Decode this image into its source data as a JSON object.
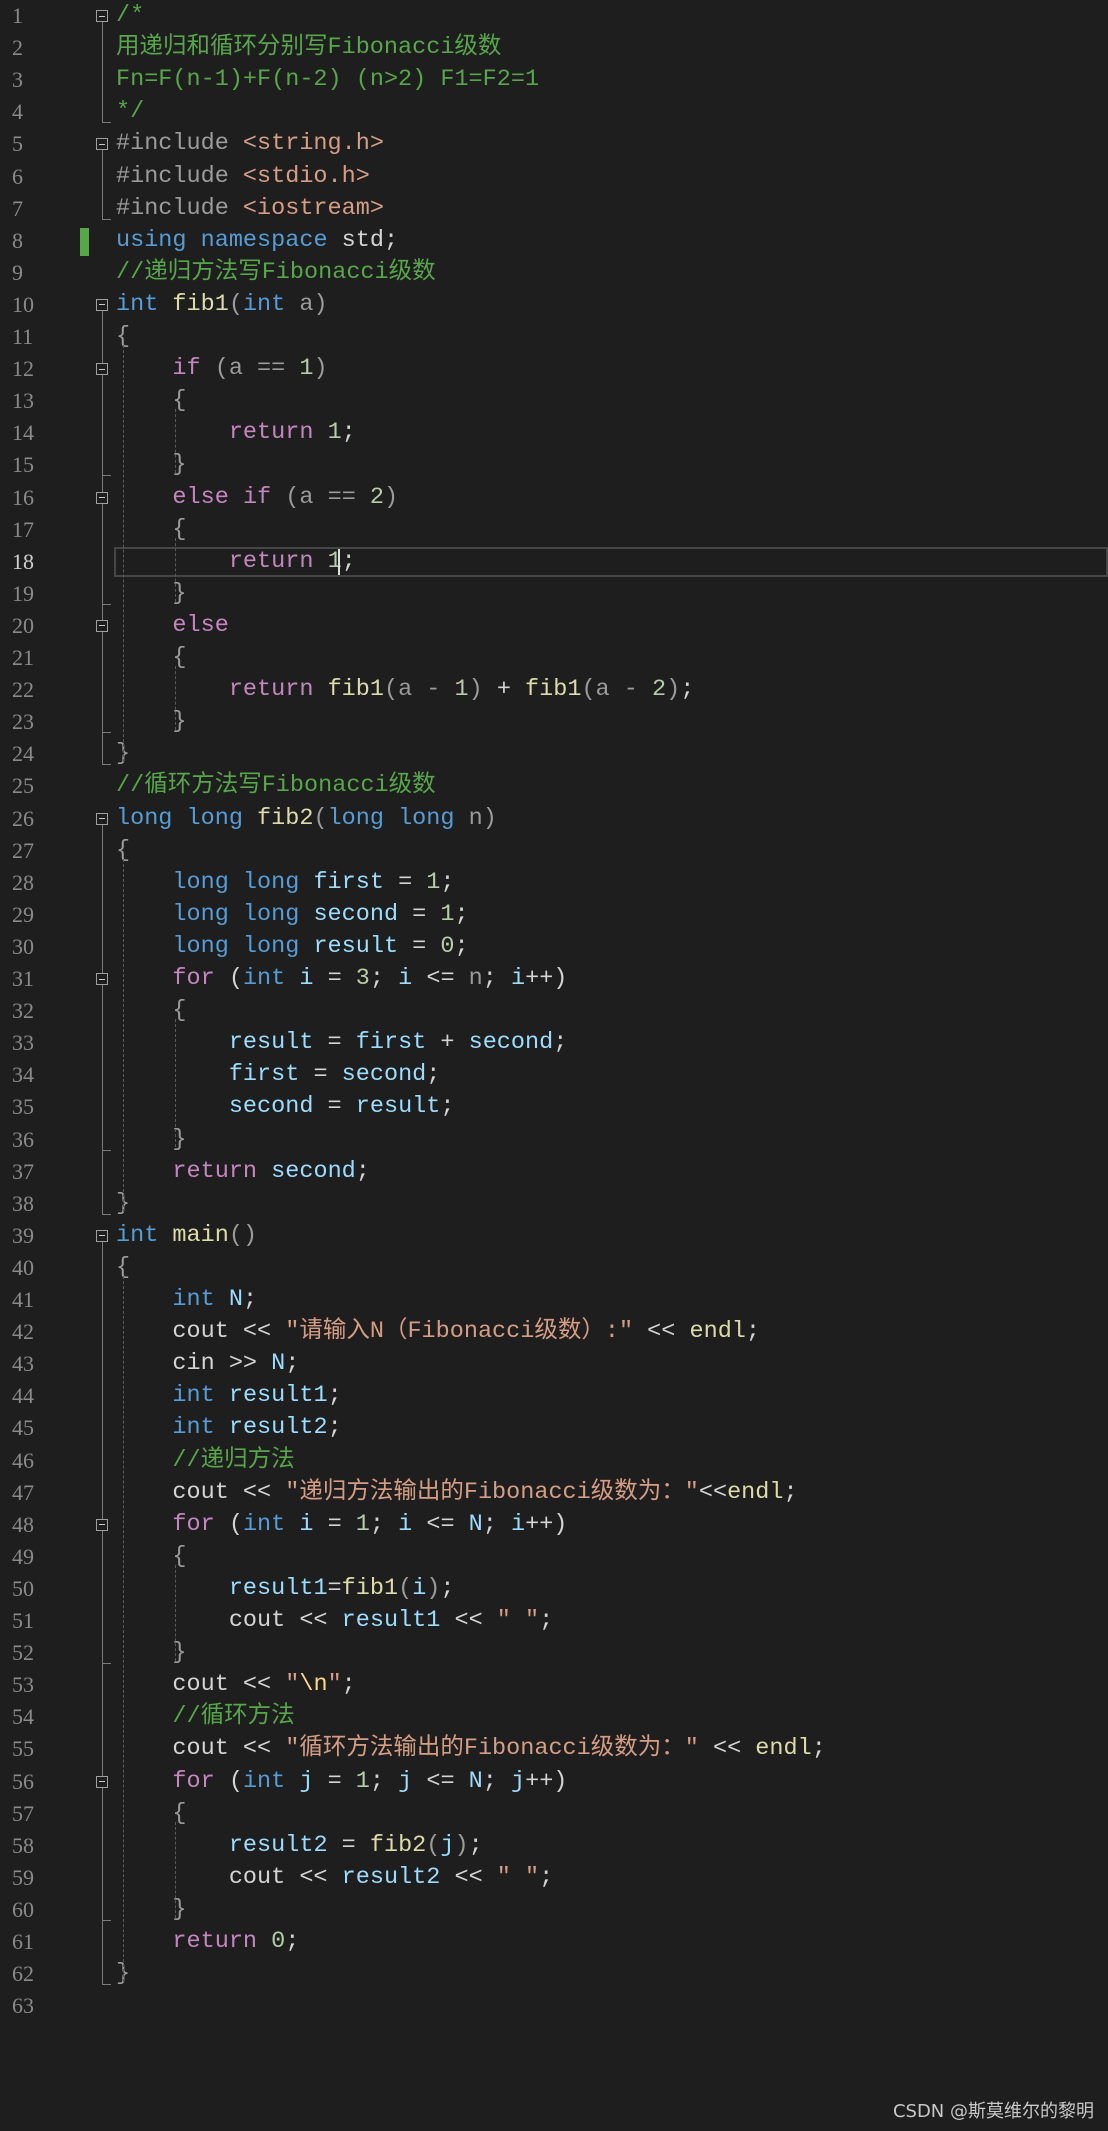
{
  "editor": {
    "active_line": 18,
    "line_numbers": [
      "1",
      "2",
      "3",
      "4",
      "5",
      "6",
      "7",
      "8",
      "9",
      "10",
      "11",
      "12",
      "13",
      "14",
      "15",
      "16",
      "17",
      "18",
      "19",
      "20",
      "21",
      "22",
      "23",
      "24",
      "25",
      "26",
      "27",
      "28",
      "29",
      "30",
      "31",
      "32",
      "33",
      "34",
      "35",
      "36",
      "37",
      "38",
      "39",
      "40",
      "41",
      "42",
      "43",
      "44",
      "45",
      "46",
      "47",
      "48",
      "49",
      "50",
      "51",
      "52",
      "53",
      "54",
      "55",
      "56",
      "57",
      "58",
      "59",
      "60",
      "61",
      "62",
      "63"
    ],
    "lines": [
      [
        [
          "cm",
          "/*"
        ]
      ],
      [
        [
          "cm",
          "用递归和循环分别写Fibonacci级数"
        ]
      ],
      [
        [
          "cm",
          "Fn=F(n-1)+F(n-2) (n>2) F1=F2=1"
        ]
      ],
      [
        [
          "cm",
          "*/"
        ]
      ],
      [
        [
          "pp",
          "#include "
        ],
        [
          "inc",
          "<string.h>"
        ]
      ],
      [
        [
          "pp",
          "#include "
        ],
        [
          "inc",
          "<stdio.h>"
        ]
      ],
      [
        [
          "pp",
          "#include "
        ],
        [
          "inc",
          "<iostream>"
        ]
      ],
      [
        [
          "k",
          "using"
        ],
        [
          "d",
          " "
        ],
        [
          "k",
          "namespace"
        ],
        [
          "d",
          " std;"
        ]
      ],
      [
        [
          "cm",
          "//递归方法写Fibonacci级数"
        ]
      ],
      [
        [
          "k",
          "int"
        ],
        [
          "d",
          " "
        ],
        [
          "f",
          "fib1"
        ],
        [
          "p",
          "("
        ],
        [
          "k",
          "int"
        ],
        [
          "d",
          " "
        ],
        [
          "p",
          "a)"
        ]
      ],
      [
        [
          "p",
          "{"
        ]
      ],
      [
        [
          "d",
          "    "
        ],
        [
          "c",
          "if"
        ],
        [
          "d",
          " "
        ],
        [
          "p",
          "(a == "
        ],
        [
          "n",
          "1"
        ],
        [
          "p",
          ")"
        ]
      ],
      [
        [
          "d",
          "    "
        ],
        [
          "p",
          "{"
        ]
      ],
      [
        [
          "d",
          "        "
        ],
        [
          "c",
          "return"
        ],
        [
          "d",
          " "
        ],
        [
          "n",
          "1"
        ],
        [
          "d",
          ";"
        ]
      ],
      [
        [
          "d",
          "    "
        ],
        [
          "p",
          "}"
        ]
      ],
      [
        [
          "d",
          "    "
        ],
        [
          "c",
          "else"
        ],
        [
          "d",
          " "
        ],
        [
          "c",
          "if"
        ],
        [
          "d",
          " "
        ],
        [
          "p",
          "(a == "
        ],
        [
          "n",
          "2"
        ],
        [
          "p",
          ")"
        ]
      ],
      [
        [
          "d",
          "    "
        ],
        [
          "p",
          "{"
        ]
      ],
      [
        [
          "d",
          "        "
        ],
        [
          "c",
          "return"
        ],
        [
          "d",
          " "
        ],
        [
          "n",
          "1"
        ],
        [
          "d",
          ";"
        ]
      ],
      [
        [
          "d",
          "    "
        ],
        [
          "p",
          "}"
        ]
      ],
      [
        [
          "d",
          "    "
        ],
        [
          "c",
          "else"
        ]
      ],
      [
        [
          "d",
          "    "
        ],
        [
          "p",
          "{"
        ]
      ],
      [
        [
          "d",
          "        "
        ],
        [
          "c",
          "return"
        ],
        [
          "d",
          " "
        ],
        [
          "f",
          "fib1"
        ],
        [
          "p",
          "(a - "
        ],
        [
          "n",
          "1"
        ],
        [
          "p",
          ")"
        ],
        [
          "d",
          " + "
        ],
        [
          "f",
          "fib1"
        ],
        [
          "p",
          "(a - "
        ],
        [
          "n",
          "2"
        ],
        [
          "p",
          ")"
        ],
        [
          "d",
          ";"
        ]
      ],
      [
        [
          "d",
          "    "
        ],
        [
          "p",
          "}"
        ]
      ],
      [
        [
          "p",
          "}"
        ]
      ],
      [
        [
          "cm",
          "//循环方法写Fibonacci级数"
        ]
      ],
      [
        [
          "k",
          "long long"
        ],
        [
          "d",
          " "
        ],
        [
          "f",
          "fib2"
        ],
        [
          "p",
          "("
        ],
        [
          "k",
          "long long"
        ],
        [
          "d",
          " "
        ],
        [
          "p",
          "n)"
        ]
      ],
      [
        [
          "p",
          "{"
        ]
      ],
      [
        [
          "d",
          "    "
        ],
        [
          "k",
          "long long"
        ],
        [
          "d",
          " "
        ],
        [
          "v",
          "first"
        ],
        [
          "d",
          " = "
        ],
        [
          "n",
          "1"
        ],
        [
          "d",
          ";"
        ]
      ],
      [
        [
          "d",
          "    "
        ],
        [
          "k",
          "long long"
        ],
        [
          "d",
          " "
        ],
        [
          "v",
          "second"
        ],
        [
          "d",
          " = "
        ],
        [
          "n",
          "1"
        ],
        [
          "d",
          ";"
        ]
      ],
      [
        [
          "d",
          "    "
        ],
        [
          "k",
          "long long"
        ],
        [
          "d",
          " "
        ],
        [
          "v",
          "result"
        ],
        [
          "d",
          " = "
        ],
        [
          "n",
          "0"
        ],
        [
          "d",
          ";"
        ]
      ],
      [
        [
          "d",
          "    "
        ],
        [
          "c",
          "for"
        ],
        [
          "d",
          " ("
        ],
        [
          "k",
          "int"
        ],
        [
          "d",
          " "
        ],
        [
          "v",
          "i"
        ],
        [
          "d",
          " = "
        ],
        [
          "n",
          "3"
        ],
        [
          "d",
          "; "
        ],
        [
          "v",
          "i"
        ],
        [
          "d",
          " <= "
        ],
        [
          "p",
          "n"
        ],
        [
          "d",
          "; "
        ],
        [
          "v",
          "i"
        ],
        [
          "d",
          "++)"
        ]
      ],
      [
        [
          "d",
          "    "
        ],
        [
          "p",
          "{"
        ]
      ],
      [
        [
          "d",
          "        "
        ],
        [
          "v",
          "result"
        ],
        [
          "d",
          " = "
        ],
        [
          "v",
          "first"
        ],
        [
          "d",
          " + "
        ],
        [
          "v",
          "second"
        ],
        [
          "d",
          ";"
        ]
      ],
      [
        [
          "d",
          "        "
        ],
        [
          "v",
          "first"
        ],
        [
          "d",
          " = "
        ],
        [
          "v",
          "second"
        ],
        [
          "d",
          ";"
        ]
      ],
      [
        [
          "d",
          "        "
        ],
        [
          "v",
          "second"
        ],
        [
          "d",
          " = "
        ],
        [
          "v",
          "result"
        ],
        [
          "d",
          ";"
        ]
      ],
      [
        [
          "d",
          "    "
        ],
        [
          "p",
          "}"
        ]
      ],
      [
        [
          "d",
          "    "
        ],
        [
          "c",
          "return"
        ],
        [
          "d",
          " "
        ],
        [
          "v",
          "second"
        ],
        [
          "d",
          ";"
        ]
      ],
      [
        [
          "p",
          "}"
        ]
      ],
      [
        [
          "k",
          "int"
        ],
        [
          "d",
          " "
        ],
        [
          "f",
          "main"
        ],
        [
          "p",
          "()"
        ]
      ],
      [
        [
          "p",
          "{"
        ]
      ],
      [
        [
          "d",
          "    "
        ],
        [
          "k",
          "int"
        ],
        [
          "d",
          " "
        ],
        [
          "v",
          "N"
        ],
        [
          "d",
          ";"
        ]
      ],
      [
        [
          "d",
          "    cout << "
        ],
        [
          "s",
          "\"请输入N（Fibonacci级数）:\""
        ],
        [
          "d",
          " << "
        ],
        [
          "f",
          "endl"
        ],
        [
          "d",
          ";"
        ]
      ],
      [
        [
          "d",
          "    cin >> "
        ],
        [
          "v",
          "N"
        ],
        [
          "d",
          ";"
        ]
      ],
      [
        [
          "d",
          "    "
        ],
        [
          "k",
          "int"
        ],
        [
          "d",
          " "
        ],
        [
          "v",
          "result1"
        ],
        [
          "d",
          ";"
        ]
      ],
      [
        [
          "d",
          "    "
        ],
        [
          "k",
          "int"
        ],
        [
          "d",
          " "
        ],
        [
          "v",
          "result2"
        ],
        [
          "d",
          ";"
        ]
      ],
      [
        [
          "d",
          "    "
        ],
        [
          "cm",
          "//递归方法"
        ]
      ],
      [
        [
          "d",
          "    cout << "
        ],
        [
          "s",
          "\"递归方法输出的Fibonacci级数为：\""
        ],
        [
          "d",
          "<<"
        ],
        [
          "f",
          "endl"
        ],
        [
          "d",
          ";"
        ]
      ],
      [
        [
          "d",
          "    "
        ],
        [
          "c",
          "for"
        ],
        [
          "d",
          " ("
        ],
        [
          "k",
          "int"
        ],
        [
          "d",
          " "
        ],
        [
          "v",
          "i"
        ],
        [
          "d",
          " = "
        ],
        [
          "n",
          "1"
        ],
        [
          "d",
          "; "
        ],
        [
          "v",
          "i"
        ],
        [
          "d",
          " <= "
        ],
        [
          "v",
          "N"
        ],
        [
          "d",
          "; "
        ],
        [
          "v",
          "i"
        ],
        [
          "d",
          "++)"
        ]
      ],
      [
        [
          "d",
          "    "
        ],
        [
          "p",
          "{"
        ]
      ],
      [
        [
          "d",
          "        "
        ],
        [
          "v",
          "result1"
        ],
        [
          "d",
          "="
        ],
        [
          "f",
          "fib1"
        ],
        [
          "p",
          "("
        ],
        [
          "v",
          "i"
        ],
        [
          "p",
          ")"
        ],
        [
          "d",
          ";"
        ]
      ],
      [
        [
          "d",
          "        cout << "
        ],
        [
          "v",
          "result1"
        ],
        [
          "d",
          " << "
        ],
        [
          "s",
          "\" \""
        ],
        [
          "d",
          ";"
        ]
      ],
      [
        [
          "d",
          "    "
        ],
        [
          "p",
          "}"
        ]
      ],
      [
        [
          "d",
          "    cout << "
        ],
        [
          "s",
          "\""
        ],
        [
          "e",
          "\\n"
        ],
        [
          "s",
          "\""
        ],
        [
          "d",
          ";"
        ]
      ],
      [
        [
          "d",
          "    "
        ],
        [
          "cm",
          "//循环方法"
        ]
      ],
      [
        [
          "d",
          "    cout << "
        ],
        [
          "s",
          "\"循环方法输出的Fibonacci级数为：\""
        ],
        [
          "d",
          " << "
        ],
        [
          "f",
          "endl"
        ],
        [
          "d",
          ";"
        ]
      ],
      [
        [
          "d",
          "    "
        ],
        [
          "c",
          "for"
        ],
        [
          "d",
          " ("
        ],
        [
          "k",
          "int"
        ],
        [
          "d",
          " "
        ],
        [
          "v",
          "j"
        ],
        [
          "d",
          " = "
        ],
        [
          "n",
          "1"
        ],
        [
          "d",
          "; "
        ],
        [
          "v",
          "j"
        ],
        [
          "d",
          " <= "
        ],
        [
          "v",
          "N"
        ],
        [
          "d",
          "; "
        ],
        [
          "v",
          "j"
        ],
        [
          "d",
          "++)"
        ]
      ],
      [
        [
          "d",
          "    "
        ],
        [
          "p",
          "{"
        ]
      ],
      [
        [
          "d",
          "        "
        ],
        [
          "v",
          "result2"
        ],
        [
          "d",
          " = "
        ],
        [
          "f",
          "fib2"
        ],
        [
          "p",
          "("
        ],
        [
          "v",
          "j"
        ],
        [
          "p",
          ")"
        ],
        [
          "d",
          ";"
        ]
      ],
      [
        [
          "d",
          "        cout << "
        ],
        [
          "v",
          "result2"
        ],
        [
          "d",
          " << "
        ],
        [
          "s",
          "\" \""
        ],
        [
          "d",
          ";"
        ]
      ],
      [
        [
          "d",
          "    "
        ],
        [
          "p",
          "}"
        ]
      ],
      [
        [
          "d",
          "    "
        ],
        [
          "c",
          "return"
        ],
        [
          "d",
          " "
        ],
        [
          "n",
          "0"
        ],
        [
          "d",
          ";"
        ]
      ],
      [
        [
          "p",
          "}"
        ]
      ],
      []
    ]
  },
  "watermark": "CSDN @斯莫维尔的黎明",
  "colors": {
    "background": "#1e1e1e",
    "keyword": "#569cd6",
    "control": "#c586c0",
    "function": "#dcdcaa",
    "variable": "#9cdcfe",
    "number": "#b5cea8",
    "string": "#d69d85",
    "comment": "#57a64a",
    "change_bar": "#57a64a"
  }
}
